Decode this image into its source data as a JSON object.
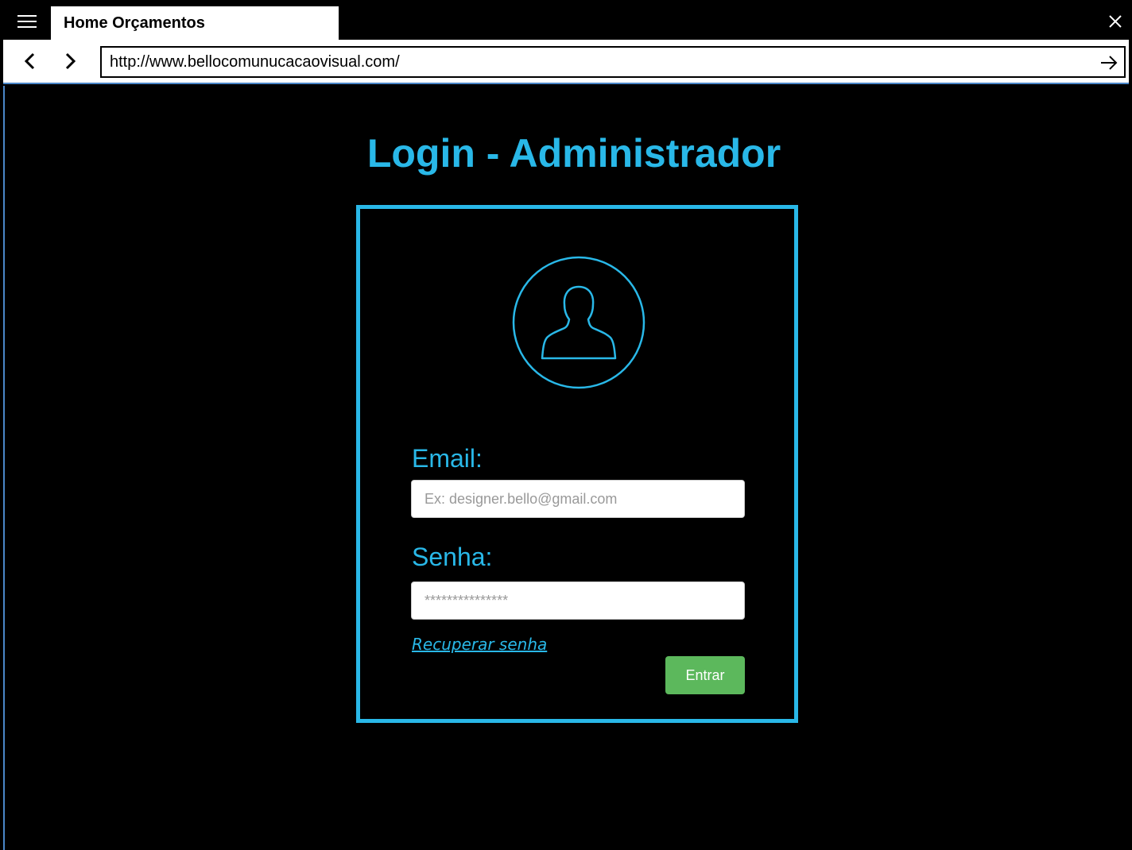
{
  "browser": {
    "tab_title": "Home Orçamentos",
    "url": "http://www.bellocomunucacaovisual.com/",
    "icons": {
      "menu": "hamburger-menu-icon",
      "close": "close-icon",
      "back": "chevron-left-icon",
      "forward": "chevron-right-icon",
      "go": "arrow-right-icon"
    }
  },
  "page": {
    "title": "Login - Administrador",
    "accent_color": "#29b8e8",
    "avatar_icon": "user-avatar-icon",
    "email": {
      "label": "Email:",
      "placeholder": "Ex: designer.bello@gmail.com",
      "value": ""
    },
    "password": {
      "label": "Senha:",
      "placeholder": "***************",
      "value": ""
    },
    "recover_link": "Recuperar senha",
    "submit_label": "Entrar",
    "submit_color": "#5cb85c"
  }
}
